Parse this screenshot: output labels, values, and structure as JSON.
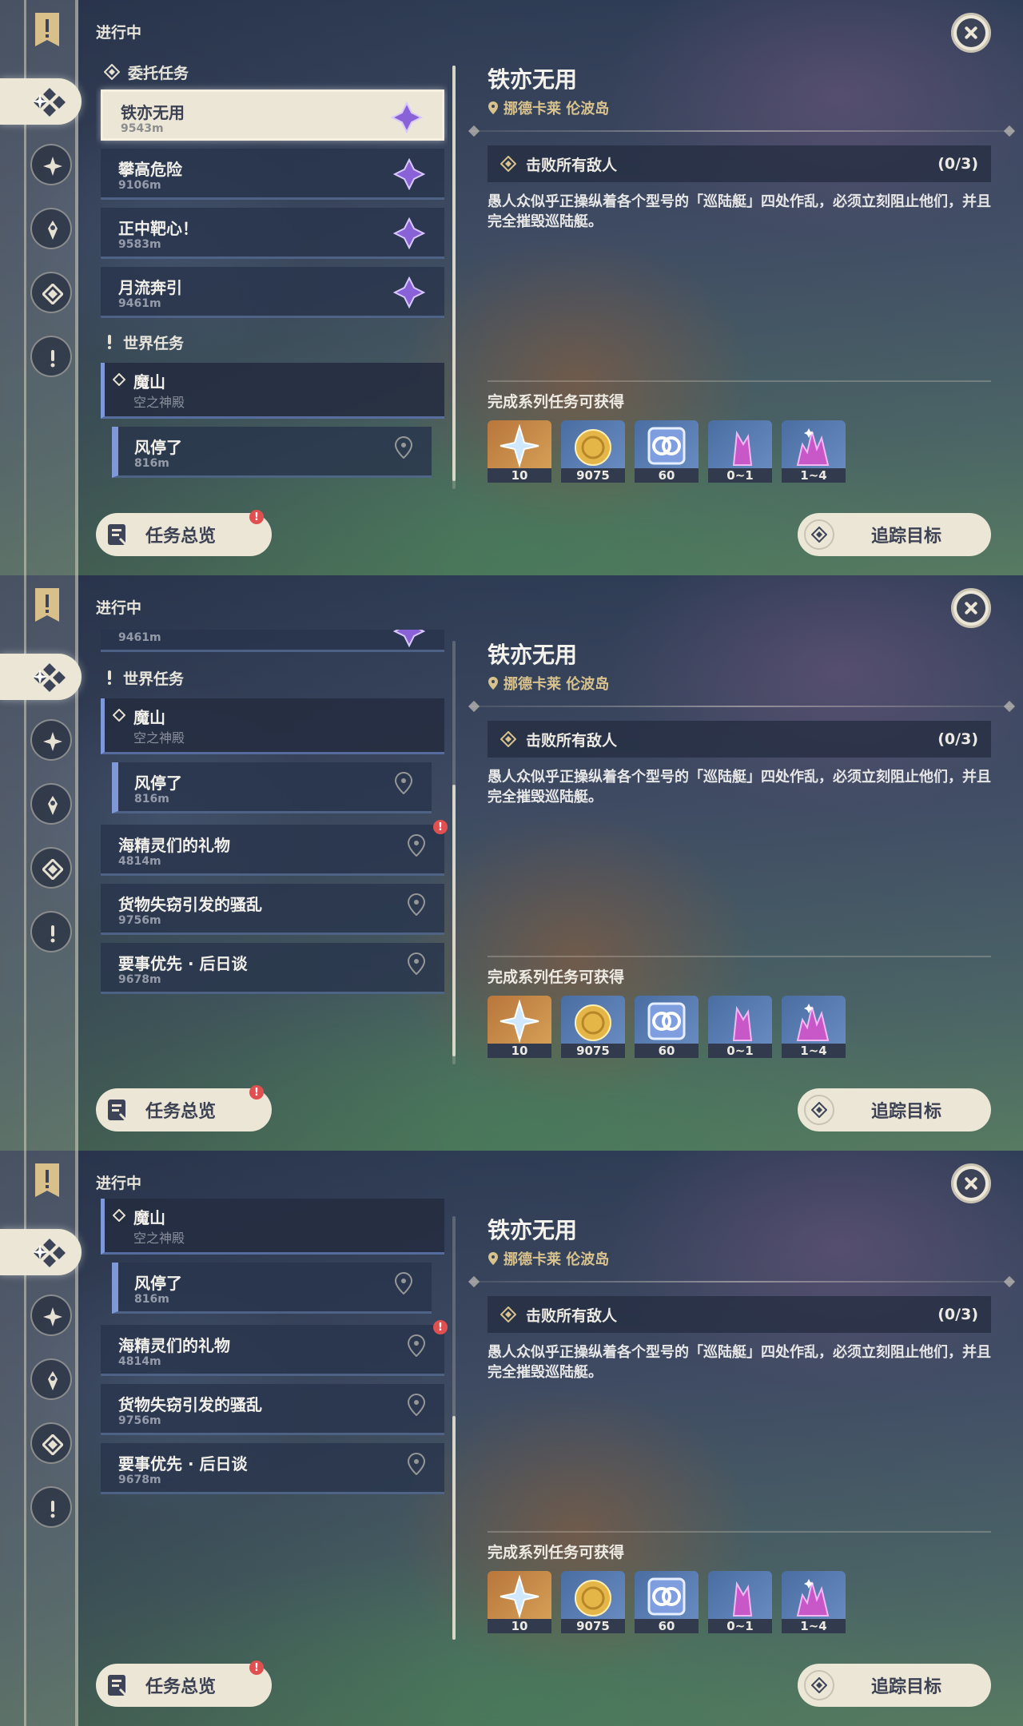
{
  "header": {
    "in_progress": "进行中"
  },
  "sections": {
    "commission": "委托任务",
    "world": "世界任务"
  },
  "commissions": [
    {
      "title": "铁亦无用",
      "dist": "9543m"
    },
    {
      "title": "攀高危险",
      "dist": "9106m"
    },
    {
      "title": "正中靶心！",
      "dist": "9583m"
    },
    {
      "title": "月流奔引",
      "dist": "9461m"
    }
  ],
  "world_quest": {
    "title": "魔山",
    "subtitle": "空之神殿",
    "step": {
      "title": "风停了",
      "dist": "816m"
    }
  },
  "other_quests": [
    {
      "title": "海精灵们的礼物",
      "dist": "4814m",
      "alert": "!"
    },
    {
      "title": "货物失窃引发的骚乱",
      "dist": "9756m"
    },
    {
      "title": "要事优先 · 后日谈",
      "dist": "9678m"
    }
  ],
  "detail": {
    "title": "铁亦无用",
    "location": "挪德卡莱 伦波岛",
    "objective": "击败所有敌人",
    "objective_count": "(0/3)",
    "description": "愚人众似乎正操纵着各个型号的「巡陆艇」四处作乱，必须立刻阻止他们，并且完全摧毁巡陆艇。",
    "reward_label": "完成系列任务可获得",
    "rewards": [
      {
        "icon": "primogem-icon",
        "qty": "10"
      },
      {
        "icon": "mora-icon",
        "qty": "9075"
      },
      {
        "icon": "friendship-icon",
        "qty": "60"
      },
      {
        "icon": "crystal-chunk-icon",
        "qty": "0~1"
      },
      {
        "icon": "crystal-cluster-icon",
        "qty": "1~4"
      }
    ]
  },
  "buttons": {
    "overview": "任务总览",
    "overview_alert": "!",
    "track": "追踪目标"
  },
  "colors": {
    "accent_gold": "#d8c38e",
    "panel_cream": "#ece6d6",
    "card_dark": "#28344c",
    "alert_red": "#e05050",
    "commission_purple": "#8a62d8"
  }
}
